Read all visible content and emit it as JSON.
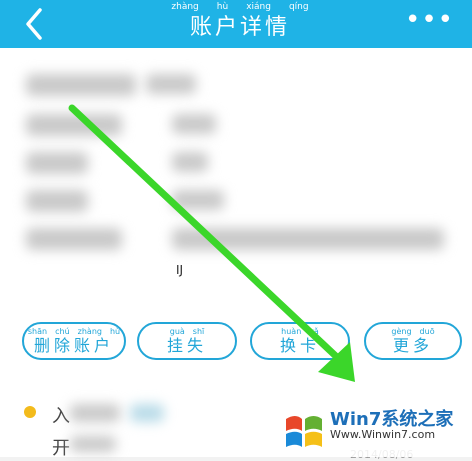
{
  "header": {
    "title": "账户详情",
    "title_pinyin": [
      "zhàng",
      "hù",
      "xiáng",
      "qíng"
    ],
    "back_icon": "chevron-left-icon",
    "more_icon": "more-dots-icon",
    "more_glyph": "•••",
    "color": "#1fb3e6"
  },
  "content": {
    "marker_text": "IJ"
  },
  "actions": [
    {
      "label": "删除账户",
      "pinyin": [
        "shān",
        "chú",
        "zhàng",
        "hù"
      ]
    },
    {
      "label": "挂失",
      "pinyin": [
        "guà",
        "shī"
      ]
    },
    {
      "label": "换卡",
      "pinyin": [
        "huàn",
        "kǎ"
      ]
    },
    {
      "label": "更多",
      "pinyin": [
        "gèng",
        "duō"
      ]
    }
  ],
  "record": {
    "char_1": "入",
    "char_2": "开",
    "date": "2014/08/06"
  },
  "watermark": {
    "title": "Win7系统之家",
    "url": "Www.Winwin7.com"
  },
  "colors": {
    "accent": "#22a6d8",
    "arrow": "#3bd62a",
    "dot": "#f3bb1c"
  }
}
